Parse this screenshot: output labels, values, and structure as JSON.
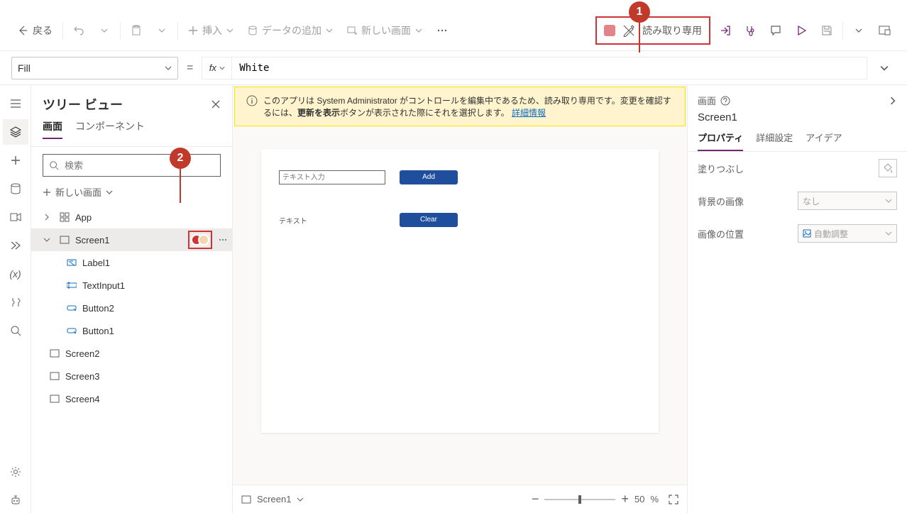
{
  "header": {
    "back": "戻る",
    "insert": "挿入",
    "add_data": "データの追加",
    "new_screen": "新しい画面",
    "readonly": "読み取り専用"
  },
  "formula": {
    "property": "Fill",
    "fx_label": "fx",
    "value": "White"
  },
  "tree": {
    "title": "ツリー ビュー",
    "tab_screens": "画面",
    "tab_components": "コンポーネント",
    "search_placeholder": "検索",
    "new_screen": "新しい画面",
    "root": "App",
    "screen1": "Screen1",
    "children": {
      "label1": "Label1",
      "textinput1": "TextInput1",
      "button2": "Button2",
      "button1": "Button1"
    },
    "screen2": "Screen2",
    "screen3": "Screen3",
    "screen4": "Screen4"
  },
  "banner": {
    "text1": "このアプリは System Administrator がコントロールを編集中であるため、読み取り専用です。変更を確認するには、",
    "bold": "更新を表示",
    "text2": "ボタンが表示された際にそれを選択します。",
    "link": "詳細情報"
  },
  "canvas": {
    "textinput_placeholder": "テキスト入力",
    "add_btn": "Add",
    "label_text": "テキスト",
    "clear_btn": "Clear"
  },
  "footer": {
    "screen": "Screen1",
    "zoom_value": "50",
    "zoom_unit": "%"
  },
  "props": {
    "head": "画面",
    "name": "Screen1",
    "tab_prop": "プロパティ",
    "tab_adv": "詳細設定",
    "tab_ideas": "アイデア",
    "fill": "塗りつぶし",
    "bg_image": "背景の画像",
    "bg_image_val": "なし",
    "image_pos": "画像の位置",
    "image_pos_val": "自動調整"
  },
  "annotations": {
    "a1": "1",
    "a2": "2"
  }
}
